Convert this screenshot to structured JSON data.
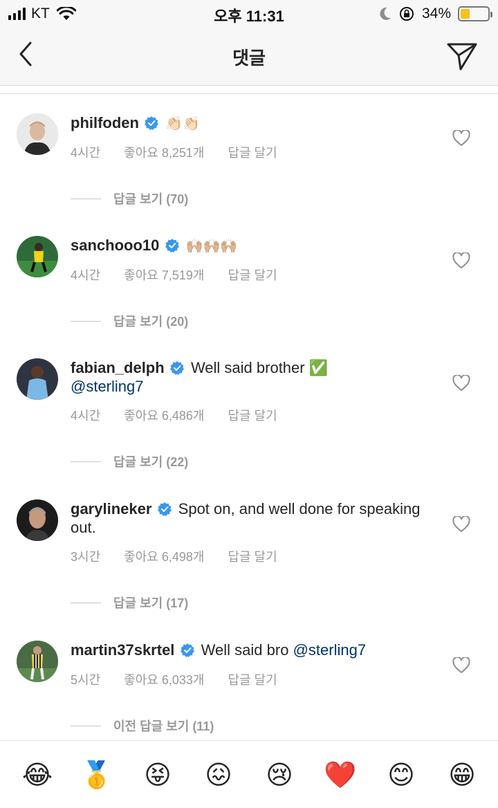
{
  "status_bar": {
    "carrier": "KT",
    "time": "오후 11:31",
    "battery_percent_label": "34%",
    "battery_level": 0.34,
    "icons": [
      "signal-icon",
      "wifi-icon",
      "moon-icon",
      "orientation-lock-icon",
      "battery-icon"
    ]
  },
  "nav": {
    "title": "댓글",
    "back_icon": "chevron-left-icon",
    "send_icon": "paper-plane-icon"
  },
  "comments": [
    {
      "username": "philfoden",
      "verified": true,
      "text": "",
      "emojis": "👏🏻👏🏻",
      "mention": "",
      "time": "4시간",
      "likes": "좋아요 8,251개",
      "reply": "답글 달기",
      "view_replies": "답글 보기 (70)"
    },
    {
      "username": "sanchooo10",
      "verified": true,
      "text": "",
      "emojis": "🙌🏼🙌🏼🙌🏼",
      "mention": "",
      "time": "4시간",
      "likes": "좋아요 7,519개",
      "reply": "답글 달기",
      "view_replies": "답글 보기 (20)"
    },
    {
      "username": "fabian_delph",
      "verified": true,
      "text": "Well said brother ✅",
      "emojis": "",
      "mention": "@sterling7",
      "time": "4시간",
      "likes": "좋아요 6,486개",
      "reply": "답글 달기",
      "view_replies": "답글 보기 (22)"
    },
    {
      "username": "garylineker",
      "verified": true,
      "text": "Spot on, and well done for speaking out.",
      "emojis": "",
      "mention": "",
      "time": "3시간",
      "likes": "좋아요 6,498개",
      "reply": "답글 달기",
      "view_replies": "답글 보기 (17)"
    },
    {
      "username": "martin37skrtel",
      "verified": true,
      "text": "Well said bro",
      "emojis": "",
      "mention": "@sterling7",
      "time": "5시간",
      "likes": "좋아요 6,033개",
      "reply": "답글 달기",
      "view_replies": "이전 답글 보기 (11)"
    }
  ],
  "emoji_bar": [
    "😂",
    "🥇",
    "😝",
    "😖",
    "😢",
    "❤️",
    "😊",
    "😁"
  ],
  "colors": {
    "text": "#262626",
    "meta": "#999999",
    "verified": "#3897f0",
    "mention": "#003569",
    "header_bg": "#f7f7f7",
    "battery": "#f6c21b"
  }
}
